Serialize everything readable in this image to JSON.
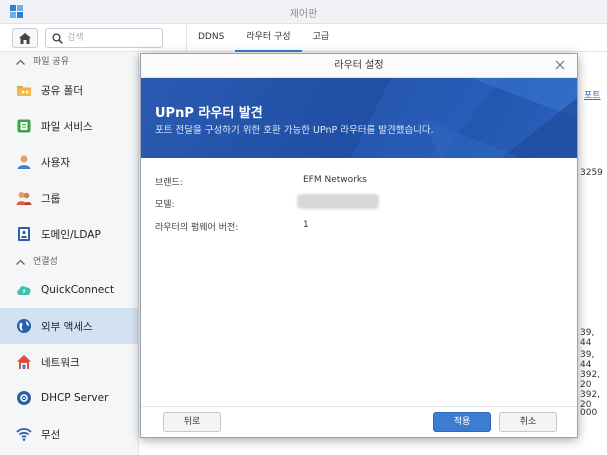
{
  "window": {
    "title": "제어판"
  },
  "toolbar": {
    "search_placeholder": "검색",
    "tabs": [
      {
        "label": "DDNS"
      },
      {
        "label": "라우터 구성"
      },
      {
        "label": "고급"
      }
    ]
  },
  "sidebar": {
    "sections": [
      {
        "label": "파일 공유",
        "items": [
          {
            "label": "공유 폴더",
            "icon": "shared-folder-icon"
          },
          {
            "label": "파일 서비스",
            "icon": "file-services-icon"
          },
          {
            "label": "사용자",
            "icon": "user-icon"
          },
          {
            "label": "그룹",
            "icon": "group-icon"
          },
          {
            "label": "도메인/LDAP",
            "icon": "domain-ldap-icon"
          }
        ]
      },
      {
        "label": "연결성",
        "items": [
          {
            "label": "QuickConnect",
            "icon": "quickconnect-icon"
          },
          {
            "label": "외부 액세스",
            "icon": "globe-icon",
            "selected": true
          },
          {
            "label": "네트워크",
            "icon": "house-network-icon"
          },
          {
            "label": "DHCP Server",
            "icon": "dhcp-server-icon"
          },
          {
            "label": "무선",
            "icon": "wifi-icon"
          }
        ]
      }
    ]
  },
  "background": {
    "col_header": "포트",
    "values": [
      "3259",
      "39, 44",
      "39, 44",
      "392, 20",
      "392, 20",
      "000"
    ]
  },
  "modal": {
    "title": "라우터 설정",
    "banner_title": "UPnP 라우터 발견",
    "banner_subtitle": "포트 전달을 구성하기 위한 호환 가능한 UPnP 라우터를 발견했습니다.",
    "fields": [
      {
        "label": "브랜드:",
        "value": "EFM Networks"
      },
      {
        "label": "모델:",
        "value": ""
      },
      {
        "label": "라우터의 펌웨어 버전:",
        "value": "1"
      }
    ],
    "buttons": {
      "back": "뒤로",
      "apply": "적용",
      "cancel": "취소"
    }
  },
  "colors": {
    "accent": "#3d7cd0",
    "banner": "#2456ad",
    "selected": "#d3e2f3"
  }
}
